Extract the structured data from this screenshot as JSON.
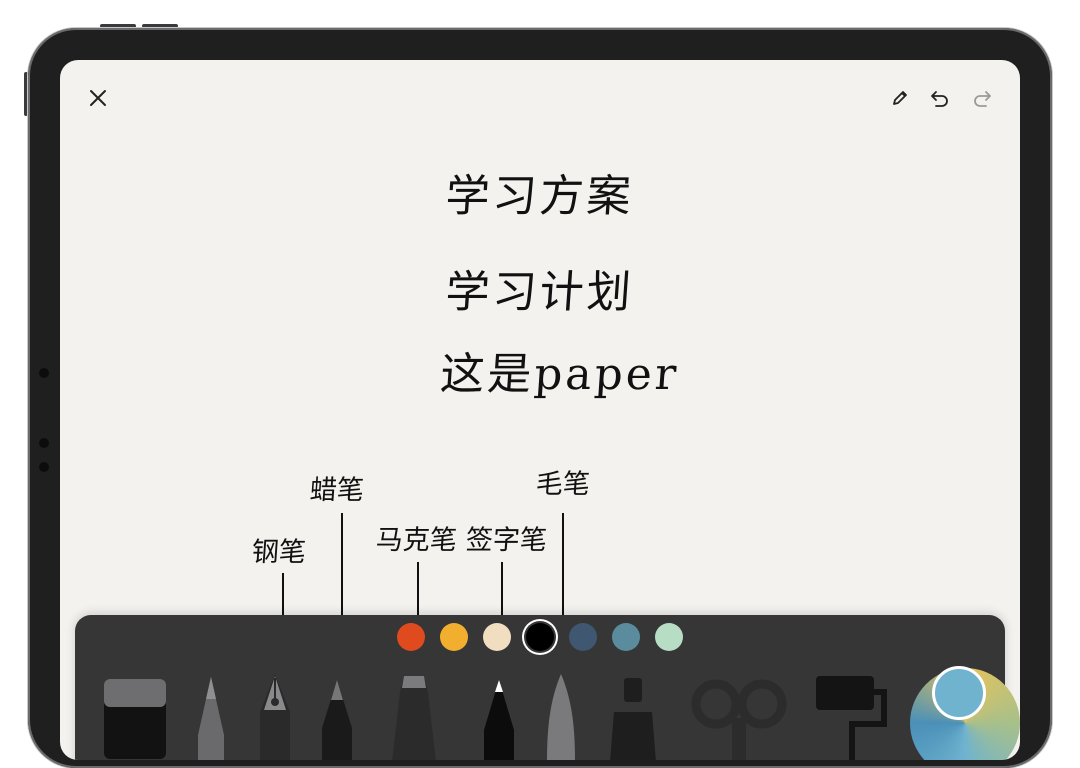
{
  "canvas": {
    "title": "学习方案",
    "line2": "学习计划",
    "line3": "这是paper"
  },
  "pens": [
    {
      "label": "钢笔"
    },
    {
      "label": "蜡笔"
    },
    {
      "label": "马克笔"
    },
    {
      "label": "签字笔"
    },
    {
      "label": "毛笔"
    }
  ],
  "toolbar_icons": {
    "close": "close-icon",
    "pencil": "pencil-icon",
    "undo": "undo-icon",
    "redo": "redo-icon"
  },
  "palette": {
    "colors": [
      "#e04a1f",
      "#f2ae2f",
      "#f1ddbf",
      "#000000",
      "#3f5770",
      "#5a8c9e",
      "#b7ddc5"
    ],
    "selected": "#000000"
  },
  "tools": [
    "eraser-icon",
    "pencil-tool-icon",
    "fountain-pen-icon",
    "crayon-icon",
    "marker-icon",
    "fineliner-icon",
    "brush-icon",
    "glue-icon",
    "scissors-icon",
    "roller-icon",
    "color-wheel-icon"
  ],
  "accent": "#6fb3cf"
}
